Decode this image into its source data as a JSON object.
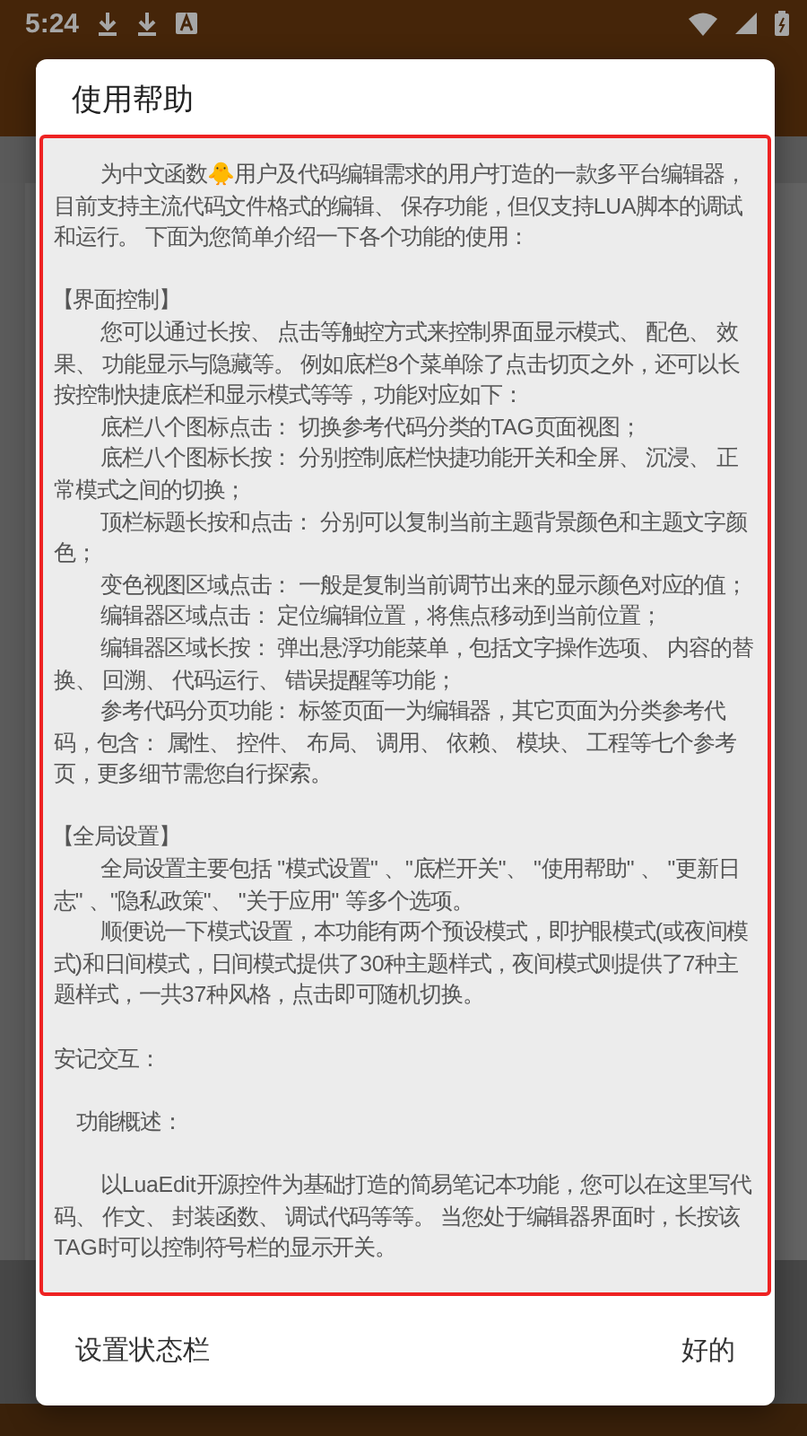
{
  "status_bar": {
    "time": "5:24"
  },
  "dialog": {
    "title": "使用帮助",
    "paragraphs": [
      {
        "kind": "indent",
        "gap_before": false,
        "text": "为中文函数🐥用户及代码编辑需求的用户打造的一款多平台编辑器，目前支持主流代码文件格式的编辑、 保存功能，但仅支持LUA脚本的调试和运行。 下面为您简单介绍一下各个功能的使用："
      },
      {
        "kind": "heading",
        "gap_before": true,
        "text": "【界面控制】"
      },
      {
        "kind": "indent",
        "gap_before": false,
        "text": "您可以通过长按、 点击等触控方式来控制界面显示模式、 配色、 效果、 功能显示与隐藏等。 例如底栏8个菜单除了点击切页之外，还可以长按控制快捷底栏和显示模式等等，功能对应如下："
      },
      {
        "kind": "indent",
        "gap_before": false,
        "text": "底栏八个图标点击： 切换参考代码分类的TAG页面视图；"
      },
      {
        "kind": "indent",
        "gap_before": false,
        "text": "底栏八个图标长按： 分别控制底栏快捷功能开关和全屏、 沉浸、 正常模式之间的切换；"
      },
      {
        "kind": "indent",
        "gap_before": false,
        "text": "顶栏标题长按和点击： 分别可以复制当前主题背景颜色和主题文字颜色；"
      },
      {
        "kind": "indent",
        "gap_before": false,
        "text": "变色视图区域点击： 一般是复制当前调节出来的显示颜色对应的值；"
      },
      {
        "kind": "indent",
        "gap_before": false,
        "text": "编辑器区域点击： 定位编辑位置，将焦点移动到当前位置；"
      },
      {
        "kind": "indent",
        "gap_before": false,
        "text": "编辑器区域长按： 弹出悬浮功能菜单，包括文字操作选项、 内容的替换、 回溯、 代码运行、 错误提醒等功能；"
      },
      {
        "kind": "indent",
        "gap_before": false,
        "text": "参考代码分页功能： 标签页面一为编辑器，其它页面为分类参考代码，包含： 属性、 控件、 布局、 调用、 依赖、 模块、 工程等七个参考页，更多细节需您自行探索。"
      },
      {
        "kind": "heading",
        "gap_before": true,
        "text": "【全局设置】"
      },
      {
        "kind": "indent",
        "gap_before": false,
        "text": "全局设置主要包括 \"模式设置\" 、\"底栏开关\"、 \"使用帮助\" 、 \"更新日志\" 、\"隐私政策\"、 \"关于应用\" 等多个选项。"
      },
      {
        "kind": "indent",
        "gap_before": false,
        "text": "顺便说一下模式设置，本功能有两个预设模式，即护眼模式(或夜间模式)和日间模式，日间模式提供了30种主题样式，夜间模式则提供了7种主题样式，一共37种风格，点击即可随机切换。"
      },
      {
        "kind": "plain",
        "gap_before": true,
        "text": "安记交互："
      },
      {
        "kind": "sub",
        "gap_before": true,
        "text": "功能概述："
      },
      {
        "kind": "indent",
        "gap_before": true,
        "text": "以LuaEdit开源控件为基础打造的简易笔记本功能，您可以在这里写代码、 作文、 封装函数、 调试代码等等。 当您处于编辑器界面时，长按该TAG时可以控制符号栏的显示开关。"
      }
    ],
    "buttons": [
      {
        "label": "设置状态栏"
      },
      {
        "label": "好的"
      }
    ]
  }
}
